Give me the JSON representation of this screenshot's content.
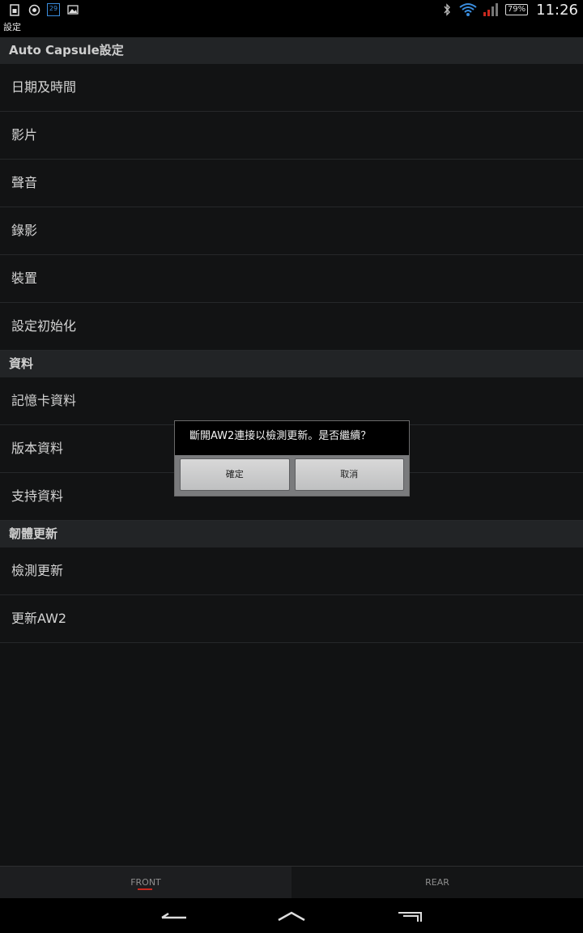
{
  "status": {
    "time": "11:26",
    "battery": "79%",
    "left_icons": [
      "sim-icon",
      "vpn-icon",
      "calendar-icon",
      "image-icon"
    ],
    "calendar_day": "29"
  },
  "titlebar": {
    "title": "設定"
  },
  "sections": [
    {
      "header": "Auto Capsule設定",
      "items": [
        "日期及時間",
        "影片",
        "聲音",
        "錄影",
        "裝置",
        "設定初始化"
      ]
    },
    {
      "header": "資料",
      "items": [
        "記憶卡資料",
        "版本資料",
        "支持資料"
      ]
    },
    {
      "header": "韌體更新",
      "items": [
        "檢測更新",
        "更新AW2"
      ]
    }
  ],
  "dialog": {
    "message": "斷開AW2連接以檢測更新。是否繼續？",
    "ok_label": "確定",
    "cancel_label": "取消"
  },
  "tabs": {
    "front": "FRONT",
    "rear": "REAR"
  },
  "colors": {
    "accent": "#c9291f",
    "wifi": "#3a8dde"
  }
}
